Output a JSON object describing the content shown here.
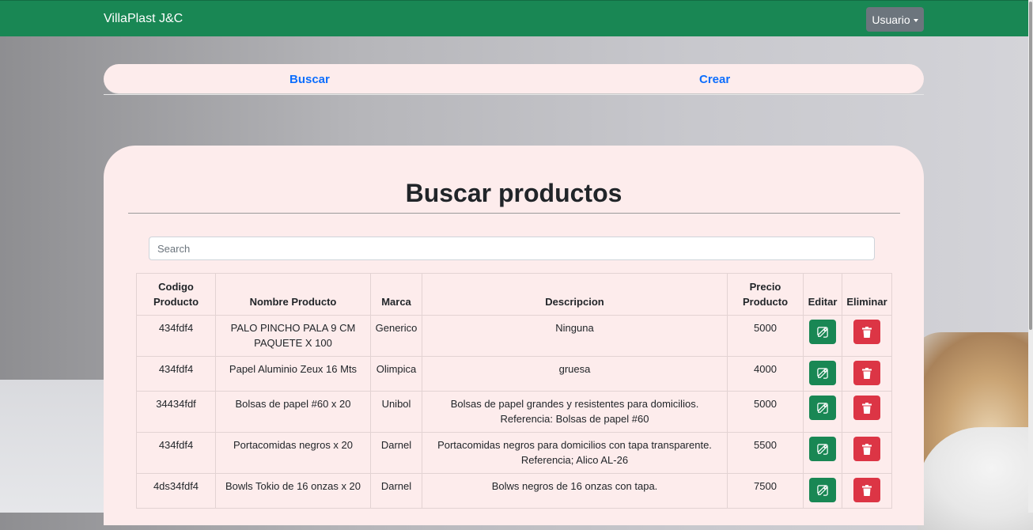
{
  "navbar": {
    "brand": "VillaPlast J&C",
    "user_button": "Usuario"
  },
  "tabs": [
    {
      "label": "Buscar"
    },
    {
      "label": "Crear"
    }
  ],
  "main": {
    "title": "Buscar productos",
    "search_placeholder": "Search"
  },
  "table": {
    "headers": {
      "code": "Codigo Producto",
      "name": "Nombre Producto",
      "brand": "Marca",
      "description": "Descripcion",
      "price": "Precio Producto",
      "edit": "Editar",
      "delete": "Eliminar"
    },
    "rows": [
      {
        "code": "434fdf4",
        "name": "PALO PINCHO PALA 9 CM PAQUETE X 100",
        "brand": "Generico",
        "description": "Ninguna",
        "price": "5000"
      },
      {
        "code": "434fdf4",
        "name": "Papel Aluminio Zeux 16 Mts",
        "brand": "Olimpica",
        "description": "gruesa",
        "price": "4000"
      },
      {
        "code": "34434fdf",
        "name": "Bolsas de papel #60 x 20",
        "brand": "Unibol",
        "description": "Bolsas de papel grandes y resistentes para domicilios. Referencia: Bolsas de papel #60",
        "price": "5000"
      },
      {
        "code": "434fdf4",
        "name": "Portacomidas negros x 20",
        "brand": "Darnel",
        "description": "Portacomidas negros para domicilios con tapa transparente. Referencia; Alico AL-26",
        "price": "5500"
      },
      {
        "code": "4ds34fdf4",
        "name": "Bowls Tokio de 16 onzas x 20",
        "brand": "Darnel",
        "description": "Bolws negros de 16 onzas con tapa.",
        "price": "7500"
      }
    ]
  },
  "colors": {
    "navbar": "#198754",
    "user_button": "#6c757d",
    "link": "#0d6efd",
    "card": "#fdecec",
    "edit_button": "#198754",
    "delete_button": "#dc3545"
  },
  "icons": {
    "edit": "edit-icon",
    "delete": "trash-icon",
    "caret": "caret-down-icon"
  }
}
